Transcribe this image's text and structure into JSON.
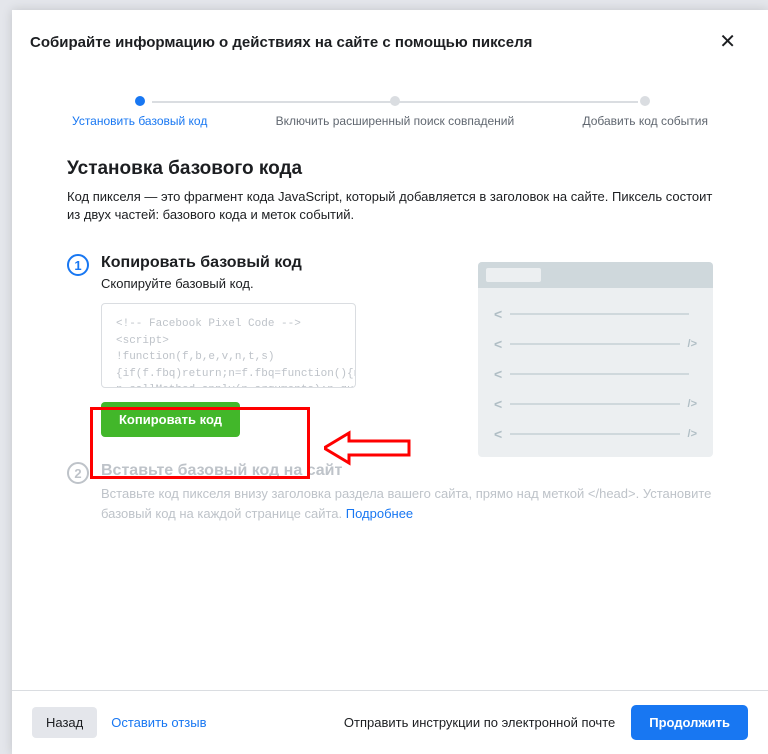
{
  "modal": {
    "title": "Собирайте информацию о действиях на сайте с помощью пикселя"
  },
  "stepper": {
    "steps": [
      {
        "label": "Установить базовый код"
      },
      {
        "label": "Включить расширенный поиск совпадений"
      },
      {
        "label": "Добавить код события"
      }
    ]
  },
  "content": {
    "title": "Установка базового кода",
    "description": "Код пикселя — это фрагмент кода JavaScript, который добавляется в заголовок на сайте. Пиксель состоит из двух частей: базового кода и меток событий."
  },
  "step1": {
    "num": "1",
    "title": "Копировать базовый код",
    "subtitle": "Скопируйте базовый код.",
    "code": "<!-- Facebook Pixel Code -->\n<script>\n!function(f,b,e,v,n,t,s)\n{if(f.fbq)return;n=f.fbq=function(){n.callMethod?\nn.callMethod.apply(n,arguments):n.queue",
    "copy_button": "Копировать код"
  },
  "step2": {
    "num": "2",
    "title": "Вставьте базовый код на сайт",
    "desc_part1": "Вставьте код пикселя внизу заголовка раздела вашего сайта, прямо над меткой </head>. Установите базовый код на каждой странице сайта. ",
    "link": "Подробнее"
  },
  "footer": {
    "back": "Назад",
    "feedback": "Оставить отзыв",
    "email": "Отправить инструкции по электронной почте",
    "continue": "Продолжить"
  }
}
